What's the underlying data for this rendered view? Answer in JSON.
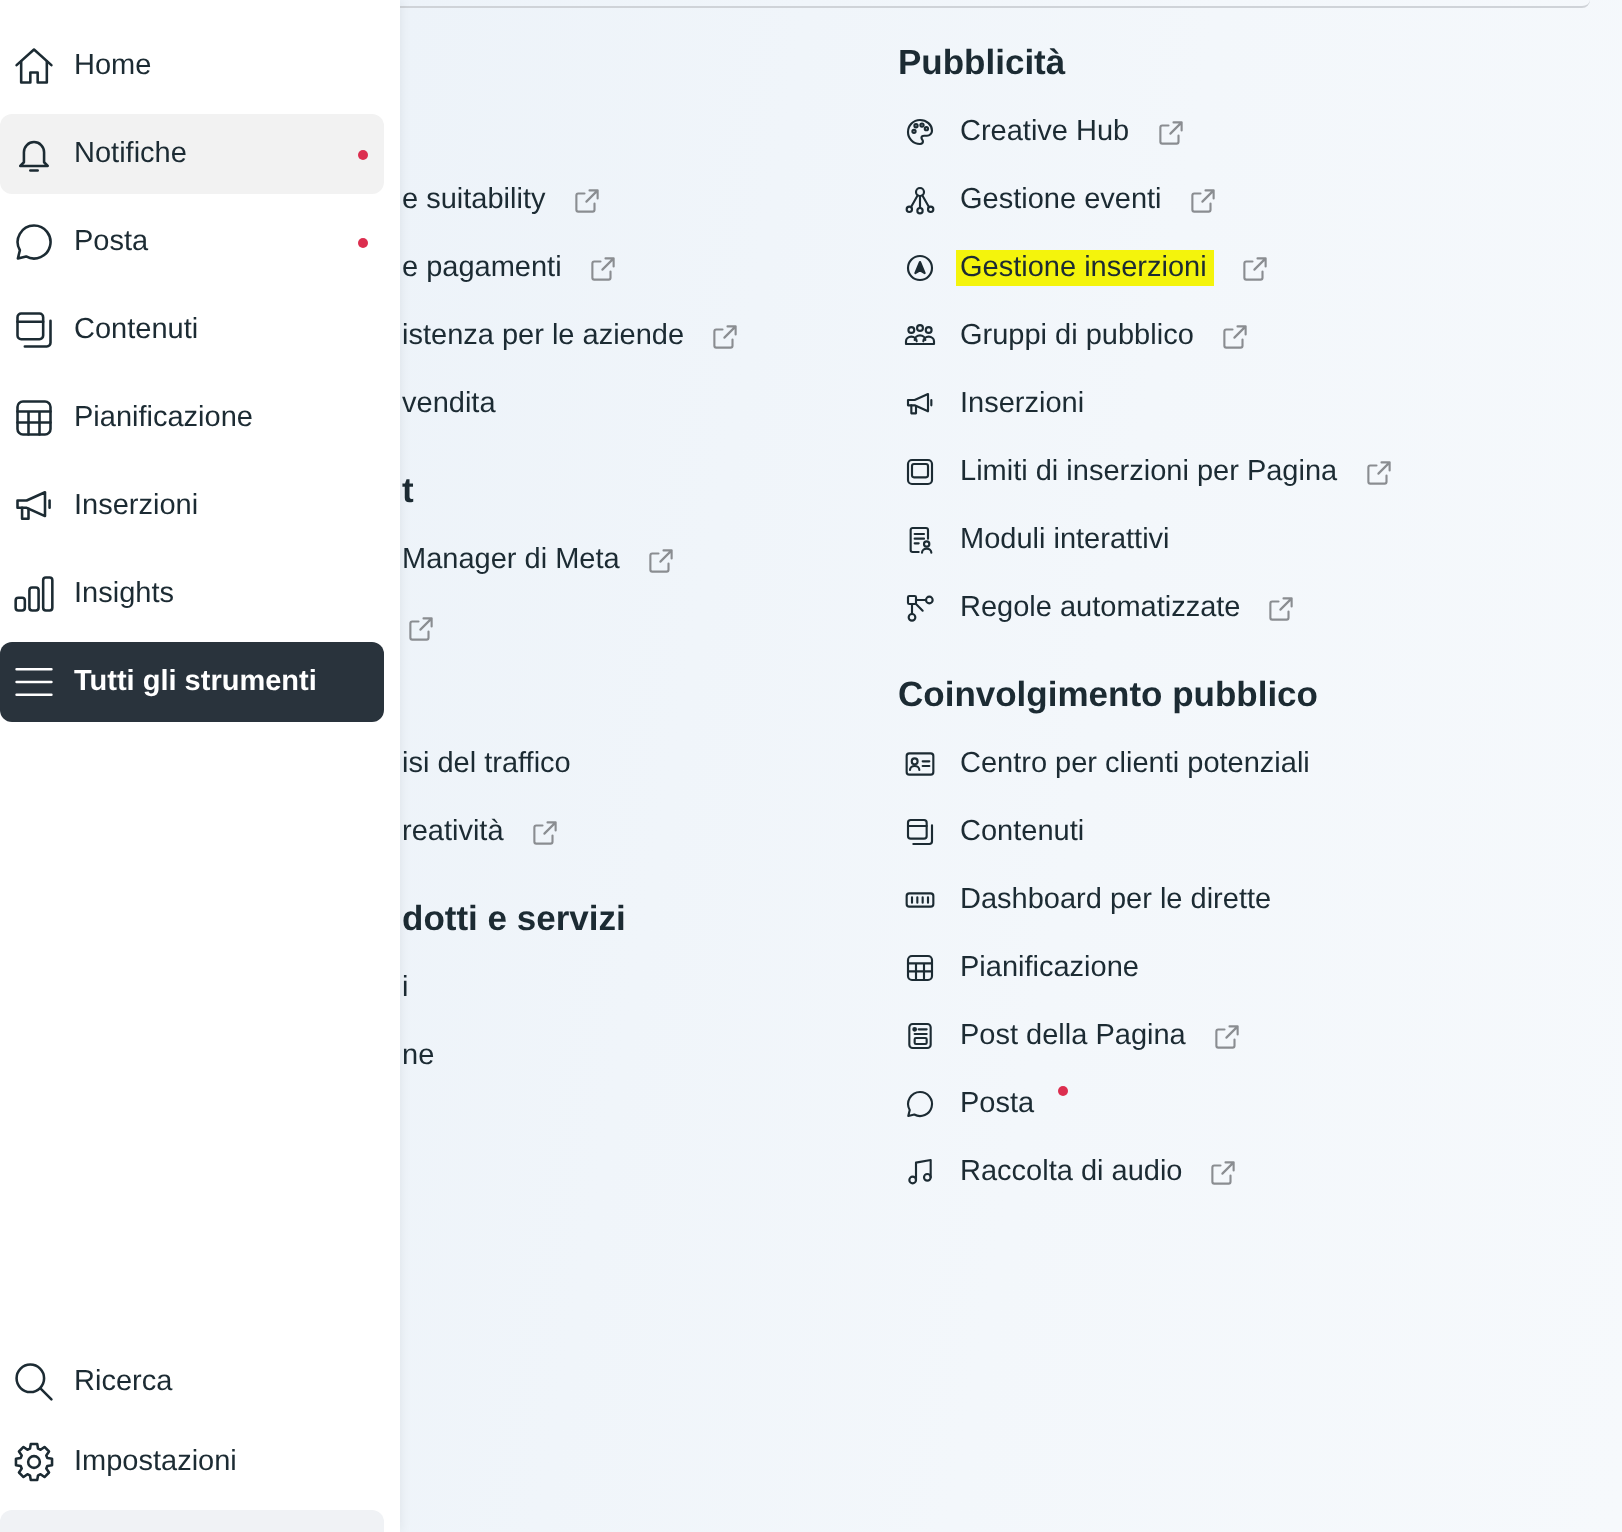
{
  "sidebar": {
    "items": [
      {
        "label": "Home",
        "selected": false,
        "hovered": false,
        "dot": false
      },
      {
        "label": "Notifiche",
        "selected": false,
        "hovered": true,
        "dot": true
      },
      {
        "label": "Posta",
        "selected": false,
        "hovered": false,
        "dot": true
      },
      {
        "label": "Contenuti",
        "selected": false,
        "hovered": false,
        "dot": false
      },
      {
        "label": "Pianificazione",
        "selected": false,
        "hovered": false,
        "dot": false
      },
      {
        "label": "Inserzioni",
        "selected": false,
        "hovered": false,
        "dot": false
      },
      {
        "label": "Insights",
        "selected": false,
        "hovered": false,
        "dot": false
      },
      {
        "label": "Tutti gli strumenti",
        "selected": true,
        "hovered": false,
        "dot": false
      }
    ],
    "bottom_items": [
      {
        "label": "Ricerca"
      },
      {
        "label": "Impostazioni"
      }
    ]
  },
  "tools": {
    "columns": [
      {
        "sections": [
          {
            "items": [
              {
                "kind": "covered"
              },
              {
                "kind": "link",
                "label": "e suitability",
                "external": true
              },
              {
                "kind": "link",
                "label": "e pagamenti",
                "external": true
              },
              {
                "kind": "link",
                "label": "istenza per le aziende",
                "external": true
              },
              {
                "kind": "link",
                "label": "vendita",
                "external": false
              }
            ]
          },
          {
            "heading": "t",
            "items": [
              {
                "kind": "link",
                "label": "Manager di Meta",
                "external": true
              },
              {
                "kind": "link",
                "external": true
              },
              {
                "kind": "covered"
              },
              {
                "kind": "link",
                "label": "isi del traffico",
                "external": false
              },
              {
                "kind": "link",
                "label": "reatività",
                "external": true
              }
            ]
          },
          {
            "heading": "dotti e servizi",
            "items": [
              {
                "kind": "link",
                "label": "i",
                "external": false
              },
              {
                "kind": "link",
                "label": "ne",
                "external": false
              }
            ]
          }
        ]
      },
      {
        "sections": [
          {
            "heading": "Pubblicità",
            "items": [
              {
                "label": "Creative Hub",
                "external": true,
                "highlighted": false
              },
              {
                "label": "Gestione eventi",
                "external": true,
                "highlighted": false
              },
              {
                "label": "Gestione inserzioni",
                "external": true,
                "highlighted": true
              },
              {
                "label": "Gruppi di pubblico",
                "external": true,
                "highlighted": false
              },
              {
                "label": "Inserzioni",
                "external": false,
                "highlighted": false
              },
              {
                "label": "Limiti di inserzioni per Pagina",
                "external": true,
                "highlighted": false
              },
              {
                "label": "Moduli interattivi",
                "external": false,
                "highlighted": false
              },
              {
                "label": "Regole automatizzate",
                "external": true,
                "highlighted": false
              }
            ]
          },
          {
            "heading": "Coinvolgimento pubblico",
            "items": [
              {
                "label": "Centro per clienti potenziali",
                "external": false,
                "dot": false
              },
              {
                "label": "Contenuti",
                "external": false,
                "dot": false
              },
              {
                "label": "Dashboard per le dirette",
                "external": false,
                "dot": false
              },
              {
                "label": "Pianificazione",
                "external": false,
                "dot": false
              },
              {
                "label": "Post della Pagina",
                "external": true,
                "dot": false
              },
              {
                "label": "Posta",
                "external": false,
                "dot": true
              },
              {
                "label": "Raccolta di audio",
                "external": true,
                "dot": false
              }
            ]
          }
        ]
      }
    ]
  }
}
